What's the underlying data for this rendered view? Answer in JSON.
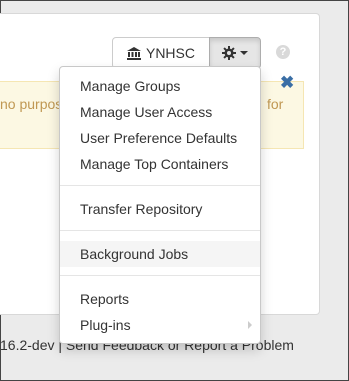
{
  "header": {
    "repository_button": "YNHSC",
    "help_icon": "?"
  },
  "alert": {
    "text_left": "no purpos",
    "text_right": "for",
    "close": "✖"
  },
  "menu": {
    "items": [
      {
        "label": "Manage Groups"
      },
      {
        "label": "Manage User Access"
      },
      {
        "label": "User Preference Defaults"
      },
      {
        "label": "Manage Top Containers"
      },
      {
        "label": "Transfer Repository"
      },
      {
        "label": "Background Jobs"
      },
      {
        "label": "Reports"
      },
      {
        "label": "Plug-ins"
      }
    ]
  },
  "footer": {
    "text": "16.2-dev | Send Feedback or Report a Problem"
  },
  "colors": {
    "alert_bg": "#fcf8e3",
    "alert_text": "#c09853",
    "close_icon": "#3a6ea5"
  }
}
